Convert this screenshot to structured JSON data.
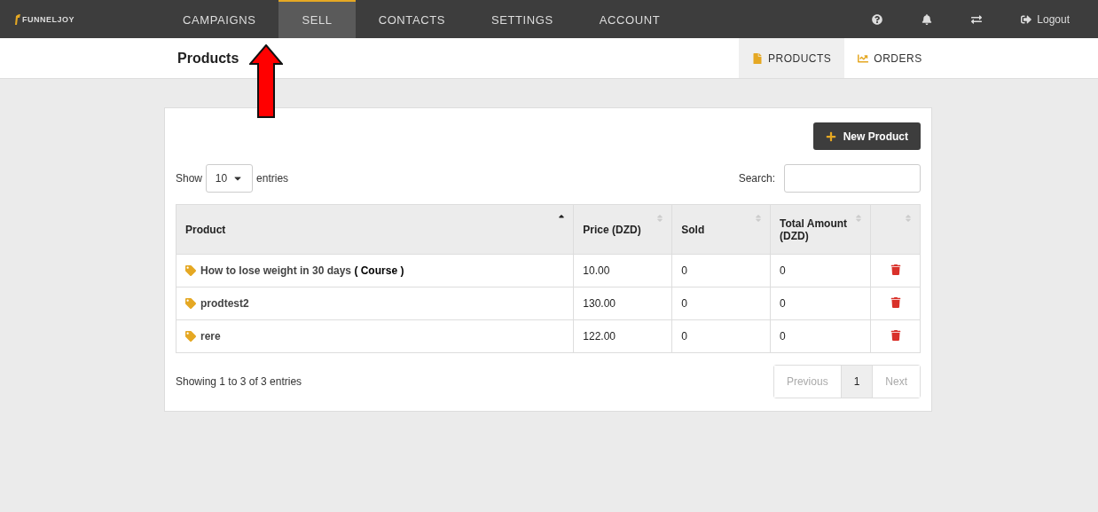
{
  "brand": "FUNNELJOY",
  "nav": [
    {
      "label": "CAMPAIGNS",
      "selected": false
    },
    {
      "label": "SELL",
      "selected": true
    },
    {
      "label": "CONTACTS",
      "selected": false
    },
    {
      "label": "SETTINGS",
      "selected": false
    },
    {
      "label": "ACCOUNT",
      "selected": false
    }
  ],
  "logout": "Logout",
  "page_title": "Products",
  "subtabs": [
    {
      "label": "PRODUCTS",
      "selected": true
    },
    {
      "label": "ORDERS",
      "selected": false
    }
  ],
  "new_button": "New Product",
  "show_label": "Show",
  "page_size": "10",
  "entries_label": "entries",
  "search_label": "Search:",
  "columns": [
    {
      "label": "Product",
      "sorted": true
    },
    {
      "label": "Price (DZD)",
      "sorted": false
    },
    {
      "label": "Sold",
      "sorted": false
    },
    {
      "label": "Total Amount (DZD)",
      "sorted": false
    },
    {
      "sorted": false
    }
  ],
  "rows": [
    {
      "product": "How to lose weight in 30 days **( Course )**",
      "price": "10.00",
      "sold": "0",
      "total": "0"
    },
    {
      "product": "prodtest2",
      "price": "130.00",
      "sold": "0",
      "total": "0"
    },
    {
      "product": "rere",
      "price": "122.00",
      "sold": "0",
      "total": "0"
    }
  ],
  "info": "Showing 1 to 3 of 3 entries",
  "pagination": [
    {
      "label": "Previous",
      "disabled": true,
      "selected": false
    },
    {
      "label": "1",
      "disabled": false,
      "selected": true
    },
    {
      "label": "Next",
      "disabled": true,
      "selected": false
    }
  ]
}
